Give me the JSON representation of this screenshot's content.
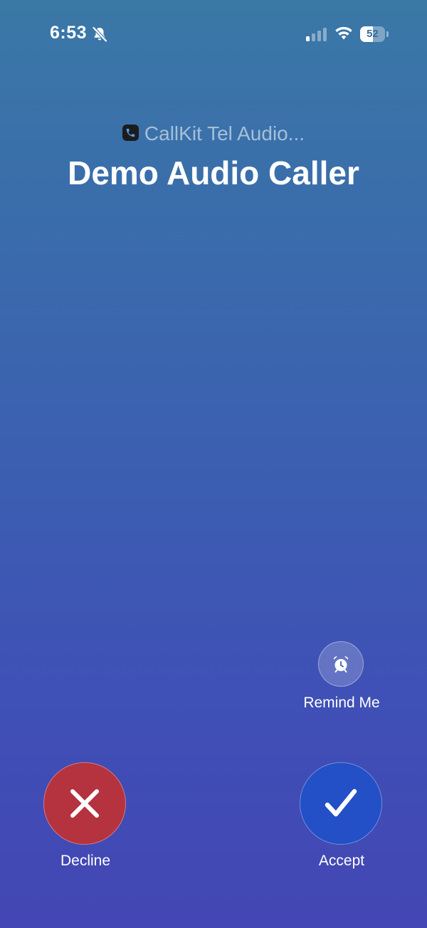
{
  "status_bar": {
    "time": "6:53",
    "battery_level": "52",
    "battery_fraction": 0.52,
    "icons": [
      "bell-slash-icon",
      "signal-icon",
      "wifi-icon",
      "battery-icon"
    ]
  },
  "call": {
    "app_name": "CallKit Tel Audio...",
    "caller_name": "Demo Audio Caller"
  },
  "actions": {
    "remind_label": "Remind Me",
    "decline_label": "Decline",
    "accept_label": "Accept"
  },
  "colors": {
    "decline": "#b5323f",
    "accept": "#234fc7",
    "background_top": "#3a78a6",
    "background_bottom": "#4346b4"
  }
}
